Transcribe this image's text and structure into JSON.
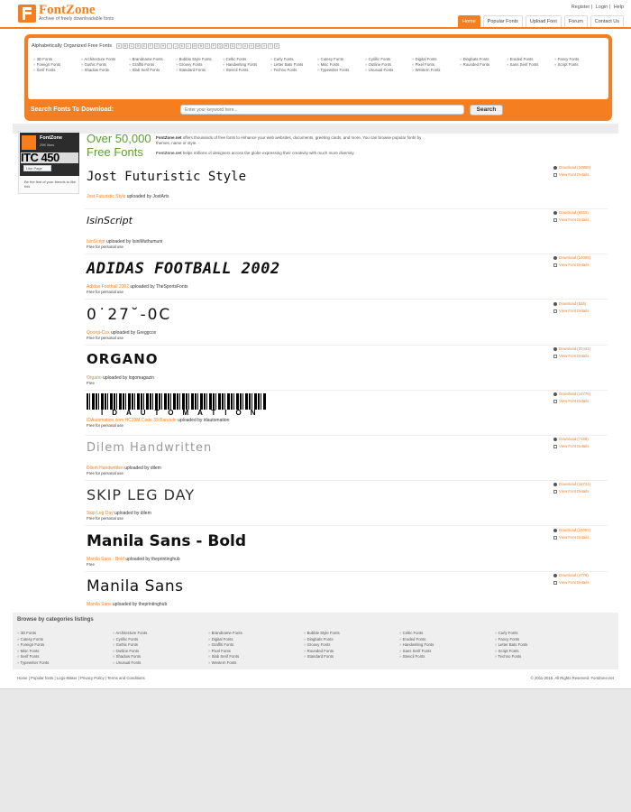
{
  "header": {
    "logo_name": "FontZone",
    "logo_tagline": "Archive of freely downloadable fonts",
    "toplinks": [
      "Register",
      "Login",
      "Help"
    ],
    "nav": [
      "Home",
      "Popular Fonts",
      "Upload Font",
      "Forum",
      "Contact Us"
    ],
    "nav_active": "Home",
    "accent_color": "#f57f20"
  },
  "alphabet": {
    "label": "Alphabetically Organized Free Fonts",
    "letters": [
      "A",
      "B",
      "C",
      "D",
      "E",
      "F",
      "G",
      "H",
      "I",
      "J",
      "K",
      "L",
      "M",
      "N",
      "O",
      "P",
      "Q",
      "R",
      "S",
      "T",
      "U",
      "V",
      "W",
      "X",
      "Y",
      "Z"
    ]
  },
  "categories": [
    [
      "3D Fonts",
      "Foreign Fonts",
      "Serif Fonts"
    ],
    [
      "Architecture Fonts",
      "Gothic Fonts",
      "Shadow Fonts"
    ],
    [
      "Brandname Fonts",
      "Graffiti Fonts",
      "Slab Serif Fonts"
    ],
    [
      "Bubble Style Fonts",
      "Groovy Fonts",
      "Standard Fonts"
    ],
    [
      "Celtic Fonts",
      "Handwriting Fonts",
      "Stencil Fonts"
    ],
    [
      "Curly Fonts",
      "Letter Bats Fonts",
      "Techno Fonts"
    ],
    [
      "Cutesy Fonts",
      "Misc Fonts",
      "Typewriter Fonts"
    ],
    [
      "Cyrillic Fonts",
      "Outline Fonts",
      "Unusual Fonts"
    ],
    [
      "Digital Fonts",
      "Pixel Fonts",
      "Western Fonts"
    ],
    [
      "Dingbats Fonts",
      "Rounded Fonts"
    ],
    [
      "Eroded Fonts",
      "Sans Serif Fonts"
    ],
    [
      "Fancy Fonts",
      "Script Fonts"
    ]
  ],
  "search": {
    "label": "Search Fonts To Download:",
    "placeholder": "Enter your keyword here...",
    "button": "Search"
  },
  "facebook": {
    "name": "FontZone",
    "likes": "29K likes",
    "banner": "ITC 450",
    "like_button": "Like Page",
    "prompt": "Be the first of your friends to like this"
  },
  "intro": {
    "title": "Over 50,000 Free Fonts",
    "brand": "FontZone.net",
    "text1": " offers thousands of free fonts to enhance your web websites, documents, greeting cards, and more. You can browse popular fonts by themes, name or style.",
    "text2": " helps millions of designers across the globe expressing their creativity with much more diversity."
  },
  "fonts": [
    {
      "preview": "Jost Futuristic Style",
      "name": "Jost Futuristic Style",
      "uploader": "JostArts",
      "license": "",
      "downloads": "Download (10858)",
      "details": "View Font Details"
    },
    {
      "preview": "IsinScript",
      "name": "IsinScript",
      "uploader": "IsiniMuthumuni",
      "license": "Free for personal use",
      "downloads": "Download (6550)",
      "details": "View Font Details"
    },
    {
      "preview": "ADIDAS FOOTBALL 2002",
      "name": "Adidas Football 2002",
      "uploader": "TheSportsFonts",
      "license": "Free for personal use",
      "downloads": "Download (14085)",
      "details": "View Font Details"
    },
    {
      "preview": "0˙27˘-0C",
      "name": "Qoorgi-Cox",
      "uploader": "Greggcox",
      "license": "Free for personal use",
      "downloads": "Download (526)",
      "details": "View Font Details"
    },
    {
      "preview": "ORGANO",
      "name": "Organo",
      "uploader": "logomagazin",
      "license": "Free",
      "downloads": "Download (37441)",
      "details": "View Font Details"
    },
    {
      "preview": "IDAUTOMATION",
      "name": "IDAutomation.com HC39M Code 39 Barcode",
      "uploader": "idautomation",
      "license": "Free for personal use",
      "downloads": "Download (16776)",
      "details": "View Font Details"
    },
    {
      "preview": "Dilem Handwritten",
      "name": "Dilem Handwritten",
      "uploader": "dilem",
      "license": "Free for personal use",
      "downloads": "Download (7198)",
      "details": "View Font Details"
    },
    {
      "preview": "SKIP LEG DAY",
      "name": "Skip Leg Day",
      "uploader": "dilem",
      "license": "Free for personal use",
      "downloads": "Download (16721)",
      "details": "View Font Details"
    },
    {
      "preview": "Manila Sans - Bold",
      "name": "Manila Sans - Bold",
      "uploader": "theprintinghub",
      "license": "Free",
      "downloads": "Download (12097)",
      "details": "View Font Details"
    },
    {
      "preview": "Manila Sans",
      "name": "Manila Sans",
      "uploader": "theprintinghub",
      "license": "",
      "downloads": "Download (4776)",
      "details": "View Font Details"
    }
  ],
  "uploaded_by": "uploaded by",
  "footer": {
    "title": "Browse by categories listings",
    "columns": [
      [
        "3D Fonts",
        "Cutesy Fonts",
        "Foreign Fonts",
        "Misc Fonts",
        "Serif Fonts",
        "Typewriter Fonts"
      ],
      [
        "Architecture Fonts",
        "Cyrillic Fonts",
        "Gothic Fonts",
        "Outline Fonts",
        "Shadow Fonts",
        "Unusual Fonts"
      ],
      [
        "Brandname Fonts",
        "Digital Fonts",
        "Graffiti Fonts",
        "Pixel Fonts",
        "Slab Serif Fonts",
        "Western Fonts"
      ],
      [
        "Bubble Style Fonts",
        "Dingbats Fonts",
        "Groovy Fonts",
        "Rounded Fonts",
        "Standard Fonts"
      ],
      [
        "Celtic Fonts",
        "Eroded Fonts",
        "Handwriting Fonts",
        "Sans Serif Fonts",
        "Stencil Fonts"
      ],
      [
        "Curly Fonts",
        "Fancy Fonts",
        "Letter Bats Fonts",
        "Script Fonts",
        "Techno Fonts"
      ]
    ],
    "links": "Home | Popular fonts | Logo Maker | Privacy Policy | Terms and Conditions",
    "copyright": "© 2011-2015. All Rights Reserved. FontZone.net"
  }
}
